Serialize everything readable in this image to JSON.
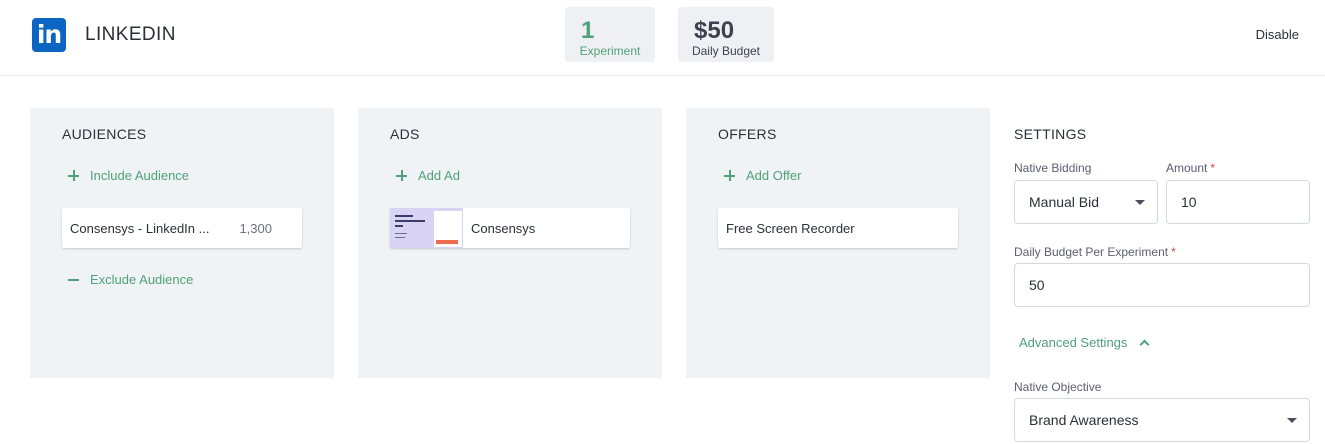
{
  "header": {
    "logo_text": "in",
    "title": "LINKEDIN",
    "stats": [
      {
        "value": "1",
        "label": "Experiment"
      },
      {
        "value": "$50",
        "label": "Daily Budget"
      }
    ],
    "disable_label": "Disable"
  },
  "audiences": {
    "title": "AUDIENCES",
    "include_label": "Include Audience",
    "items": [
      {
        "name": "Consensys - LinkedIn ...",
        "count": "1,300"
      }
    ],
    "exclude_label": "Exclude Audience"
  },
  "ads": {
    "title": "ADS",
    "add_label": "Add Ad",
    "items": [
      {
        "name": "Consensys"
      }
    ]
  },
  "offers": {
    "title": "OFFERS",
    "add_label": "Add Offer",
    "items": [
      {
        "name": "Free Screen Recorder"
      }
    ]
  },
  "settings": {
    "title": "SETTINGS",
    "native_bidding": {
      "label": "Native Bidding",
      "value": "Manual Bid"
    },
    "amount": {
      "label": "Amount",
      "required": "*",
      "value": "10"
    },
    "daily_budget": {
      "label": "Daily Budget Per Experiment",
      "required": "*",
      "value": "50"
    },
    "advanced_label": "Advanced Settings",
    "native_objective": {
      "label": "Native Objective",
      "value": "Brand Awareness"
    }
  },
  "colors": {
    "accent": "#4fa17a",
    "linkedin_blue": "#0a66c2",
    "panel_bg": "#f0f3f6",
    "required": "#e0463d"
  },
  "icons": [
    "linkedin-logo-icon",
    "plus-icon",
    "minus-icon",
    "chevron-up-icon",
    "caret-down-icon"
  ]
}
